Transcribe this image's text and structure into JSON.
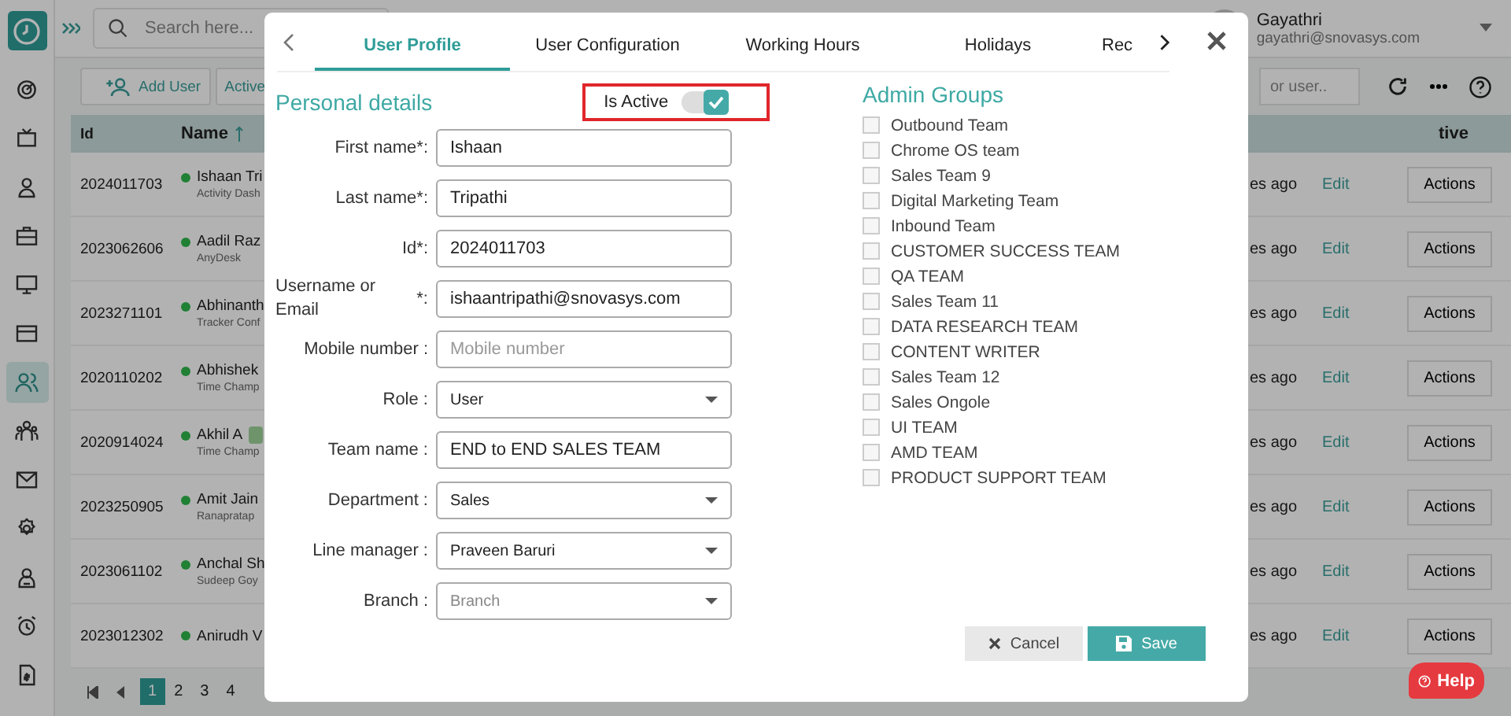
{
  "app": {
    "search_placeholder": "Search here..."
  },
  "user": {
    "name": "Gayathri",
    "email": "gayathri@snovasys.com"
  },
  "sidebar": {
    "items": [
      {
        "selected": false
      },
      {
        "selected": false
      },
      {
        "selected": false
      },
      {
        "selected": false
      },
      {
        "selected": false
      },
      {
        "selected": false
      },
      {
        "selected": true
      },
      {
        "selected": false
      },
      {
        "selected": false
      },
      {
        "selected": false
      },
      {
        "selected": false
      },
      {
        "selected": false
      },
      {
        "selected": false
      }
    ]
  },
  "toolbar": {
    "buttons": [
      "Add User",
      "Active"
    ],
    "search_placeholder": "or user.."
  },
  "table": {
    "columns": [
      "Id",
      "Name",
      "tive"
    ],
    "rows": [
      {
        "id": "2024011703",
        "name": "Ishaan Tri",
        "subtitle": "Activity Dash",
        "badge": false,
        "last_active": "es ago",
        "edit": "Edit",
        "actions": "Actions"
      },
      {
        "id": "2023062606",
        "name": "Aadil Raz",
        "subtitle": "AnyDesk",
        "badge": false,
        "last_active": "es ago",
        "edit": "Edit",
        "actions": "Actions"
      },
      {
        "id": "2023271101",
        "name": "Abhinanth",
        "subtitle": "Tracker Conf",
        "badge": false,
        "last_active": "es ago",
        "edit": "Edit",
        "actions": "Actions"
      },
      {
        "id": "2020110202",
        "name": "Abhishek",
        "subtitle": "Time Champ",
        "badge": false,
        "last_active": "es ago",
        "edit": "Edit",
        "actions": "Actions"
      },
      {
        "id": "2020914024",
        "name": "Akhil A",
        "subtitle": "Time Champ",
        "badge": true,
        "last_active": "es ago",
        "edit": "Edit",
        "actions": "Actions"
      },
      {
        "id": "2023250905",
        "name": "Amit Jain",
        "subtitle": "Ranapratap",
        "badge": false,
        "last_active": "es ago",
        "edit": "Edit",
        "actions": "Actions"
      },
      {
        "id": "2023061102",
        "name": "Anchal Sh",
        "subtitle": "Sudeep Goy",
        "badge": false,
        "last_active": "es ago",
        "edit": "Edit",
        "actions": "Actions"
      },
      {
        "id": "2023012302",
        "name": "Anirudh V",
        "subtitle": "",
        "badge": false,
        "last_active": "es ago",
        "edit": "Edit",
        "actions": "Actions"
      }
    ]
  },
  "pagination": {
    "pages": [
      {
        "label": "1",
        "selected": true
      },
      {
        "label": "2",
        "selected": false
      },
      {
        "label": "3",
        "selected": false
      },
      {
        "label": "4",
        "selected": false
      }
    ]
  },
  "modal": {
    "tabs": [
      {
        "label": "User Profile",
        "selected": true
      },
      {
        "label": "User Configuration",
        "selected": false
      },
      {
        "label": "Working Hours",
        "selected": false
      },
      {
        "label": "Holidays",
        "selected": false
      },
      {
        "label": "Rec",
        "selected": false
      }
    ],
    "personal": {
      "title": "Personal details",
      "active_label": "Is Active",
      "is_active": true,
      "highlighted": true,
      "fields": [
        {
          "kind": "text",
          "label": "First name*:",
          "value": "Ishaan"
        },
        {
          "kind": "text",
          "label": "Last name*:",
          "value": "Tripathi"
        },
        {
          "kind": "text",
          "label": "Id*:",
          "value": "2024011703"
        },
        {
          "kind": "text",
          "label": "Username or Email",
          "suffix": "*:",
          "value": "ishaantripathi@snovasys.com"
        },
        {
          "kind": "text",
          "label": "Mobile number :",
          "placeholder": "Mobile number"
        },
        {
          "kind": "select",
          "label": "Role :",
          "value": "User"
        },
        {
          "kind": "text",
          "label": "Team name :",
          "value": "END to END SALES TEAM"
        },
        {
          "kind": "select",
          "label": "Department :",
          "value": "Sales"
        },
        {
          "kind": "select",
          "label": "Line manager :",
          "value": "Praveen Baruri"
        },
        {
          "kind": "select",
          "label": "Branch :",
          "placeholder": "Branch"
        }
      ]
    },
    "admin_groups": {
      "title": "Admin Groups",
      "items": [
        {
          "label": "Outbound Team",
          "checked": false
        },
        {
          "label": "Chrome OS team",
          "checked": false
        },
        {
          "label": "Sales Team 9",
          "checked": false
        },
        {
          "label": "Digital Marketing Team",
          "checked": false
        },
        {
          "label": "Inbound Team",
          "checked": false
        },
        {
          "label": "CUSTOMER SUCCESS TEAM",
          "checked": false
        },
        {
          "label": "QA TEAM",
          "checked": false
        },
        {
          "label": "Sales Team 11",
          "checked": false
        },
        {
          "label": "DATA RESEARCH TEAM",
          "checked": false
        },
        {
          "label": "CONTENT WRITER",
          "checked": false
        },
        {
          "label": "Sales Team 12",
          "checked": false
        },
        {
          "label": "Sales Ongole",
          "checked": false
        },
        {
          "label": "UI TEAM",
          "checked": false
        },
        {
          "label": "AMD TEAM",
          "checked": false
        },
        {
          "label": "PRODUCT SUPPORT TEAM",
          "checked": false
        }
      ]
    },
    "cancel": "Cancel",
    "save": "Save"
  },
  "help": {
    "label": "Help"
  }
}
